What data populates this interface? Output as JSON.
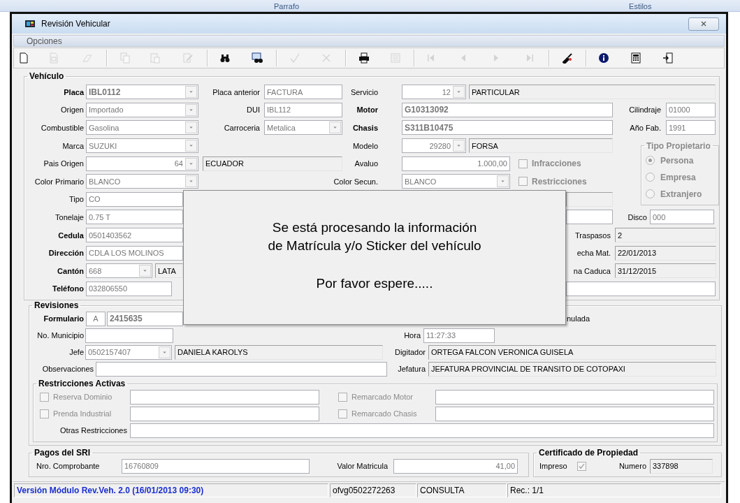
{
  "ribbon": {
    "labels": [
      "Parrafo",
      "Estilos"
    ]
  },
  "window": {
    "title": "Revisión Vehicular"
  },
  "menu": [
    "Opciones"
  ],
  "toolbar": {
    "buttons": [
      {
        "disabled": false
      },
      {
        "disabled": true
      },
      {
        "disabled": true
      },
      {
        "disabled": true
      },
      {
        "disabled": true
      },
      {
        "disabled": true
      },
      {
        "disabled": false
      },
      {
        "disabled": false
      },
      {
        "disabled": true
      },
      {
        "disabled": true
      },
      {
        "disabled": false
      },
      {
        "disabled": true
      },
      {
        "disabled": true
      },
      {
        "disabled": true
      },
      {
        "disabled": true
      },
      {
        "disabled": true
      },
      {
        "disabled": false
      },
      {
        "disabled": false
      },
      {
        "disabled": false
      },
      {
        "disabled": false
      }
    ]
  },
  "vehiculo": {
    "legend": "Vehículo",
    "rows": [
      {
        "items": [
          {
            "kind": "label",
            "text": "Placa",
            "bold": true
          },
          {
            "kind": "combo",
            "value": "IBL0112",
            "bold": true
          },
          {
            "kind": "label",
            "text": "Placa anterior"
          },
          {
            "kind": "text",
            "value": "FACTURA"
          },
          {
            "kind": "label",
            "text": "Servicio"
          },
          {
            "kind": "combo",
            "value": "12"
          },
          {
            "kind": "display",
            "value": "PARTICULAR"
          }
        ]
      },
      {
        "items": [
          {
            "kind": "label",
            "text": "Origen"
          },
          {
            "kind": "combo",
            "value": "Importado"
          },
          {
            "kind": "label",
            "text": "DUI"
          },
          {
            "kind": "text",
            "value": "IBL112"
          },
          {
            "kind": "label",
            "text": "Motor",
            "bold": true
          },
          {
            "kind": "text",
            "value": "G10313092",
            "bold": true
          },
          {
            "kind": "label",
            "text": "Cilindraje"
          },
          {
            "kind": "text",
            "value": "01000"
          }
        ]
      },
      {
        "items": [
          {
            "kind": "label",
            "text": "Combustible"
          },
          {
            "kind": "combo",
            "value": "Gasolina"
          },
          {
            "kind": "label",
            "text": "Carroceria"
          },
          {
            "kind": "combo",
            "value": "Metalica"
          },
          {
            "kind": "label",
            "text": "Chasis",
            "bold": true
          },
          {
            "kind": "text",
            "value": "S311B10475",
            "bold": true
          },
          {
            "kind": "label",
            "text": "Año Fab."
          },
          {
            "kind": "text",
            "value": "1991"
          }
        ]
      },
      {
        "items": [
          {
            "kind": "label",
            "text": "Marca"
          },
          {
            "kind": "combo",
            "value": "SUZUKI"
          },
          {
            "kind": "label",
            "text": "Modelo"
          },
          {
            "kind": "combo",
            "value": "29280"
          },
          {
            "kind": "display",
            "value": "FORSA"
          }
        ]
      },
      {
        "items": [
          {
            "kind": "label",
            "text": "Pais Origen"
          },
          {
            "kind": "combo",
            "value": "64"
          },
          {
            "kind": "display",
            "value": "ECUADOR"
          },
          {
            "kind": "label",
            "text": "Avaluo"
          },
          {
            "kind": "text",
            "value": "1.000,00"
          },
          {
            "kind": "check",
            "text": "Infracciones",
            "bold": true,
            "checked": false,
            "disabled": true
          }
        ]
      },
      {
        "items": [
          {
            "kind": "label",
            "text": "Color Primario"
          },
          {
            "kind": "combo",
            "value": "BLANCO"
          },
          {
            "kind": "label",
            "text": "Color Secun."
          },
          {
            "kind": "combo",
            "value": "BLANCO"
          },
          {
            "kind": "check",
            "text": "Restricciones",
            "bold": true,
            "checked": false,
            "disabled": true
          }
        ]
      },
      {
        "items": [
          {
            "kind": "label",
            "text": "Tipo"
          },
          {
            "kind": "text",
            "value": "CO"
          },
          {
            "kind": "display"
          }
        ]
      },
      {
        "items": [
          {
            "kind": "label",
            "text": "Tonelaje"
          },
          {
            "kind": "text",
            "value": "0.75 T"
          },
          {
            "kind": "text"
          },
          {
            "kind": "label",
            "text": "Disco"
          },
          {
            "kind": "text",
            "value": "000"
          }
        ]
      },
      {
        "items": [
          {
            "kind": "label",
            "text": "Cedula",
            "bold": true
          },
          {
            "kind": "text",
            "value": "0501403562"
          },
          {
            "kind": "label",
            "text": "Traspasos"
          },
          {
            "kind": "display",
            "value": "2"
          }
        ]
      },
      {
        "items": [
          {
            "kind": "label",
            "text": "Dirección",
            "bold": true
          },
          {
            "kind": "text",
            "value": "CDLA LOS MOLINOS"
          },
          {
            "kind": "label",
            "text": "echa Mat."
          },
          {
            "kind": "display",
            "value": "22/01/2013"
          }
        ]
      },
      {
        "items": [
          {
            "kind": "label",
            "text": "Cantón",
            "bold": true
          },
          {
            "kind": "combo",
            "value": "668"
          },
          {
            "kind": "display",
            "value": "LATA"
          },
          {
            "kind": "label",
            "text": "na Caduca"
          },
          {
            "kind": "display",
            "value": "31/12/2015"
          }
        ]
      },
      {
        "items": [
          {
            "kind": "label",
            "text": "Teléfono",
            "bold": true
          },
          {
            "kind": "text",
            "value": "032806550"
          },
          {
            "kind": "text"
          }
        ]
      }
    ]
  },
  "tipo_propietario": {
    "legend": "Tipo Propietario",
    "options": [
      {
        "text": "Persona",
        "selected": true,
        "disabled": true
      },
      {
        "text": "Empresa",
        "selected": false,
        "disabled": true
      },
      {
        "text": "Extranjero",
        "selected": false,
        "disabled": true
      }
    ]
  },
  "revisiones": {
    "legend": "Revisiones",
    "rows": [
      {
        "items": [
          {
            "kind": "label",
            "text": "Formulario",
            "bold": true
          },
          {
            "kind": "text",
            "value": "A"
          },
          {
            "kind": "text",
            "value": "2415635",
            "bold": true
          },
          {
            "kind": "label",
            "text": "nulada"
          }
        ]
      },
      {
        "items": [
          {
            "kind": "label",
            "text": "No. Municipio"
          },
          {
            "kind": "text"
          },
          {
            "kind": "label",
            "text": "Hora"
          },
          {
            "kind": "text",
            "value": "11:27:33"
          }
        ]
      },
      {
        "items": [
          {
            "kind": "label",
            "text": "Jefe"
          },
          {
            "kind": "combo",
            "value": "0502157407"
          },
          {
            "kind": "display",
            "value": "DANIELA KAROLYS"
          },
          {
            "kind": "label",
            "text": "Digitador"
          },
          {
            "kind": "display",
            "value": "ORTEGA FALCON VERONICA GUISELA"
          }
        ]
      },
      {
        "items": [
          {
            "kind": "label",
            "text": "Observaciones"
          },
          {
            "kind": "text"
          },
          {
            "kind": "label",
            "text": "Jefatura"
          },
          {
            "kind": "display",
            "value": "JEFATURA PROVINCIAL DE TRANSITO DE COTOPAXI"
          }
        ]
      }
    ]
  },
  "restricciones": {
    "legend": "Restricciones Activas",
    "rows": [
      {
        "items": [
          {
            "kind": "check",
            "text": "Reserva Dominio",
            "checked": false,
            "disabled": true
          },
          {
            "kind": "text"
          },
          {
            "kind": "check",
            "text": "Remarcado Motor",
            "checked": false,
            "disabled": true
          },
          {
            "kind": "text"
          }
        ]
      },
      {
        "items": [
          {
            "kind": "check",
            "text": "Prenda Industrial",
            "checked": false,
            "disabled": true
          },
          {
            "kind": "text"
          },
          {
            "kind": "check",
            "text": "Remarcado Chasis",
            "checked": false,
            "disabled": true
          },
          {
            "kind": "text"
          }
        ]
      },
      {
        "items": [
          {
            "kind": "label",
            "text": "Otras Restricciones"
          },
          {
            "kind": "text"
          }
        ]
      }
    ]
  },
  "pagos": {
    "legend": "Pagos del SRI",
    "rows": [
      {
        "items": [
          {
            "kind": "label",
            "text": "Nro. Comprobante"
          },
          {
            "kind": "text",
            "value": "16760809"
          },
          {
            "kind": "label",
            "text": "Valor Matricula"
          },
          {
            "kind": "text",
            "value": "41,00"
          }
        ]
      }
    ]
  },
  "certificado": {
    "legend": "Certificado de Propiedad",
    "rows": [
      {
        "items": [
          {
            "kind": "label",
            "text": "Impreso"
          },
          {
            "kind": "check",
            "checked": true,
            "disabled": true
          },
          {
            "kind": "label",
            "text": "Numero"
          },
          {
            "kind": "display",
            "value": "337898"
          }
        ]
      }
    ]
  },
  "status_bar": [
    {
      "kind": "version",
      "text": "Versión Módulo Rev.Veh. 2.0 (16/01/2013 09:30)"
    },
    {
      "kind": "cell",
      "text": "ofvg0502272263"
    },
    {
      "kind": "cell",
      "text": "CONSULTA"
    },
    {
      "kind": "cell",
      "text": "Rec.: 1/1"
    }
  ],
  "message": {
    "lines": [
      "Se está procesando la información",
      "de Matrícula y/o Sticker del vehículo"
    ],
    "wait": "Por favor espere....."
  }
}
